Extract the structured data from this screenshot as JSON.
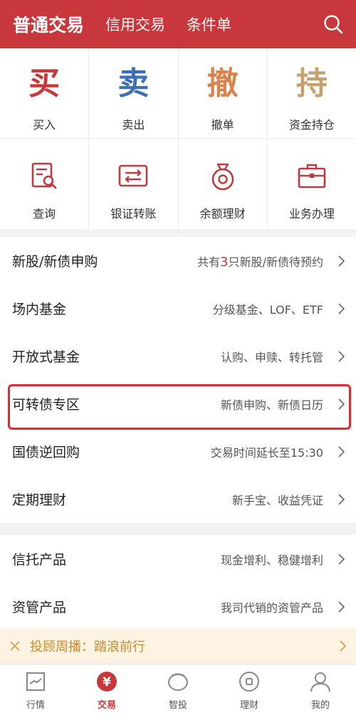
{
  "header": {
    "tabs": [
      "普通交易",
      "信用交易",
      "条件单"
    ],
    "search_icon": "search-icon"
  },
  "grid": {
    "row1": [
      {
        "char": "买",
        "label": "买入",
        "color": "#c8373b"
      },
      {
        "char": "卖",
        "label": "卖出",
        "color": "#3b6fb6"
      },
      {
        "char": "撤",
        "label": "撤单",
        "color": "#d9824c"
      },
      {
        "char": "持",
        "label": "资金持仓",
        "color": "#c6a06d"
      }
    ],
    "row2": [
      {
        "icon": "query-icon",
        "label": "查询"
      },
      {
        "icon": "transfer-icon",
        "label": "银证转账"
      },
      {
        "icon": "money-bag-icon",
        "label": "余额理财"
      },
      {
        "icon": "briefcase-icon",
        "label": "业务办理"
      }
    ]
  },
  "list1": [
    {
      "title": "新股/新债申购",
      "desc_pre": "共有",
      "desc_num": "3",
      "desc_post": "只新股/新债待预约"
    },
    {
      "title": "场内基金",
      "desc": "分级基金、LOF、ETF"
    },
    {
      "title": "开放式基金",
      "desc": "认购、申赎、转托管"
    },
    {
      "title": "可转债专区",
      "desc": "新债申购、新债日历"
    },
    {
      "title": "国债逆回购",
      "desc": "交易时间延长至15:30"
    },
    {
      "title": "定期理财",
      "desc": "新手宝、收益凭证"
    }
  ],
  "list2": [
    {
      "title": "信托产品",
      "desc": "现金增利、稳健增利"
    },
    {
      "title": "资管产品",
      "desc": "我司代销的资管产品"
    }
  ],
  "notice": {
    "text": "投顾周播：踏浪前行"
  },
  "tabbar": [
    {
      "label": "行情",
      "icon": "chart-icon"
    },
    {
      "label": "交易",
      "icon": "yuan-icon"
    },
    {
      "label": "智投",
      "icon": "smart-icon"
    },
    {
      "label": "理财",
      "icon": "wealth-icon"
    },
    {
      "label": "我的",
      "icon": "user-icon"
    }
  ],
  "colors": {
    "accent": "#c8373b",
    "highlight": "#e8262b",
    "notice_text": "#c98a2a"
  }
}
